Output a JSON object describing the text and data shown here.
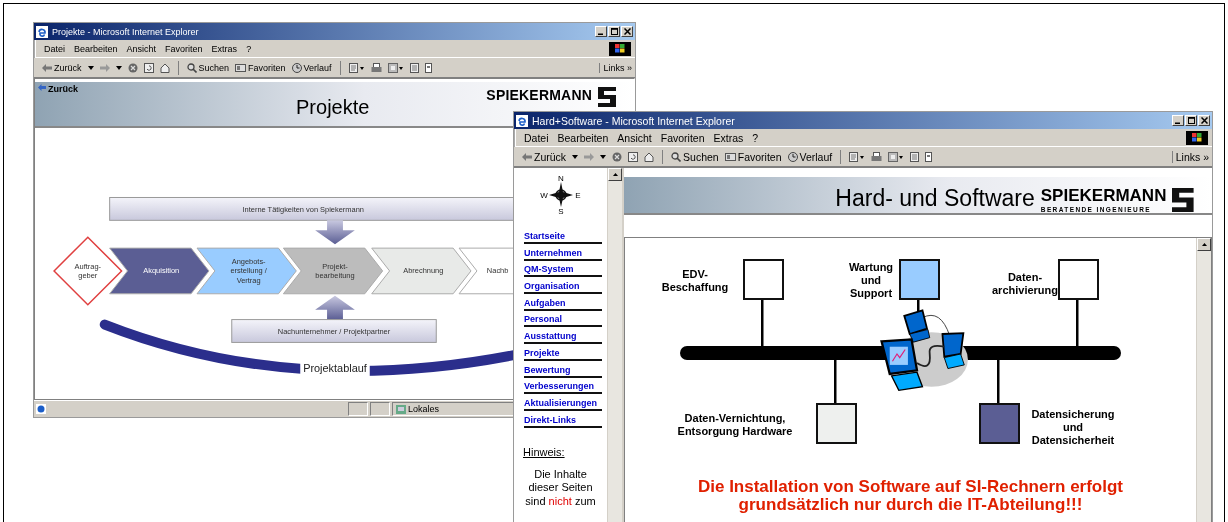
{
  "windows": [
    {
      "kind": "process",
      "title": "Projekte - Microsoft Internet Explorer",
      "menu": [
        "Datei",
        "Bearbeiten",
        "Ansicht",
        "Favoriten",
        "Extras",
        "?"
      ],
      "toolbar": [
        {
          "kind": "back",
          "label": "Zurück"
        },
        {
          "kind": "forward"
        },
        {
          "kind": "stop"
        },
        {
          "kind": "refresh"
        },
        {
          "kind": "home"
        },
        {
          "kind": "search",
          "label": "Suchen"
        },
        {
          "kind": "favorites",
          "label": "Favoriten"
        },
        {
          "kind": "history",
          "label": "Verlauf"
        },
        {
          "kind": "mail"
        },
        {
          "kind": "print"
        },
        {
          "kind": "edit"
        },
        {
          "kind": "discuss"
        },
        {
          "kind": "messenger"
        }
      ],
      "links": {
        "label": "Links",
        "more": "»"
      },
      "header": {
        "back_link": "Zurück",
        "title": "Projekte",
        "logo": "SPIEKERMANN"
      },
      "diagram": {
        "top_bar": "Interne Tätigkeiten von Spiekermann",
        "client": "Auftrag-\ngeber",
        "steps": [
          {
            "label": "Akquisition",
            "color": "#5b5e94"
          },
          {
            "label": "Angebots-\nerstellung /\nVertrag",
            "color": "#99ccff"
          },
          {
            "label": "Projekt-\nbearbeitung",
            "color": "#bcbcbc"
          },
          {
            "label": "Abrechnung",
            "color": "#e8eae8"
          },
          {
            "label": "Nachb",
            "color": "#ffffff"
          }
        ],
        "bottom_bar": "Nachunternehmer / Projektpartner",
        "timeline": "Projektablauf"
      },
      "status": {
        "zone": "Lokales"
      }
    },
    {
      "kind": "network",
      "title": "Hard+Software - Microsoft Internet Explorer",
      "menu": [
        "Datei",
        "Bearbeiten",
        "Ansicht",
        "Favoriten",
        "Extras",
        "?"
      ],
      "toolbar": [
        {
          "kind": "back",
          "label": "Zurück"
        },
        {
          "kind": "forward"
        },
        {
          "kind": "stop"
        },
        {
          "kind": "refresh"
        },
        {
          "kind": "home"
        },
        {
          "kind": "search",
          "label": "Suchen"
        },
        {
          "kind": "favorites",
          "label": "Favoriten"
        },
        {
          "kind": "history",
          "label": "Verlauf"
        },
        {
          "kind": "mail"
        },
        {
          "kind": "print"
        },
        {
          "kind": "edit"
        },
        {
          "kind": "discuss"
        },
        {
          "kind": "messenger"
        }
      ],
      "links": {
        "label": "Links",
        "more": "»"
      },
      "sidebar": {
        "compass": [
          "N",
          "E",
          "S",
          "W"
        ],
        "links": [
          "Startseite",
          "Unternehmen",
          "QM-System",
          "Organisation",
          "Aufgaben",
          "Personal",
          "Ausstattung",
          "Projekte",
          "Bewertung",
          "Verbesserungen",
          "Aktualisierungen",
          "Direkt-Links"
        ],
        "hint_title": "Hinweis:",
        "note": {
          "text": "Die Inhalte dieser Seiten sind",
          "highlight": "nicht",
          "rest": "zum"
        }
      },
      "header": {
        "title": "Hard- und Software",
        "logo": "SPIEKERMANN",
        "tagline": "BERATENDE INGENIEURE"
      },
      "diagram": {
        "nodes": [
          {
            "label": "EDV-\nBeschaffung",
            "color": "#ffffff"
          },
          {
            "label": "Wartung\nund\nSupport",
            "color": "#99ccff"
          },
          {
            "label": "Daten-\narchivierung",
            "color": "#ffffff"
          },
          {
            "label": "Daten-Vernichtung,\nEntsorgung Hardware",
            "color": "#eef0ee"
          },
          {
            "label": "Datensicherung\nund\nDatensicherheit",
            "color": "#5b5e94"
          }
        ]
      },
      "notice": "Die Installation von Software auf SI-Rechnern erfolgt grundsätzlich nur durch die IT-Abteilung!!!"
    }
  ]
}
